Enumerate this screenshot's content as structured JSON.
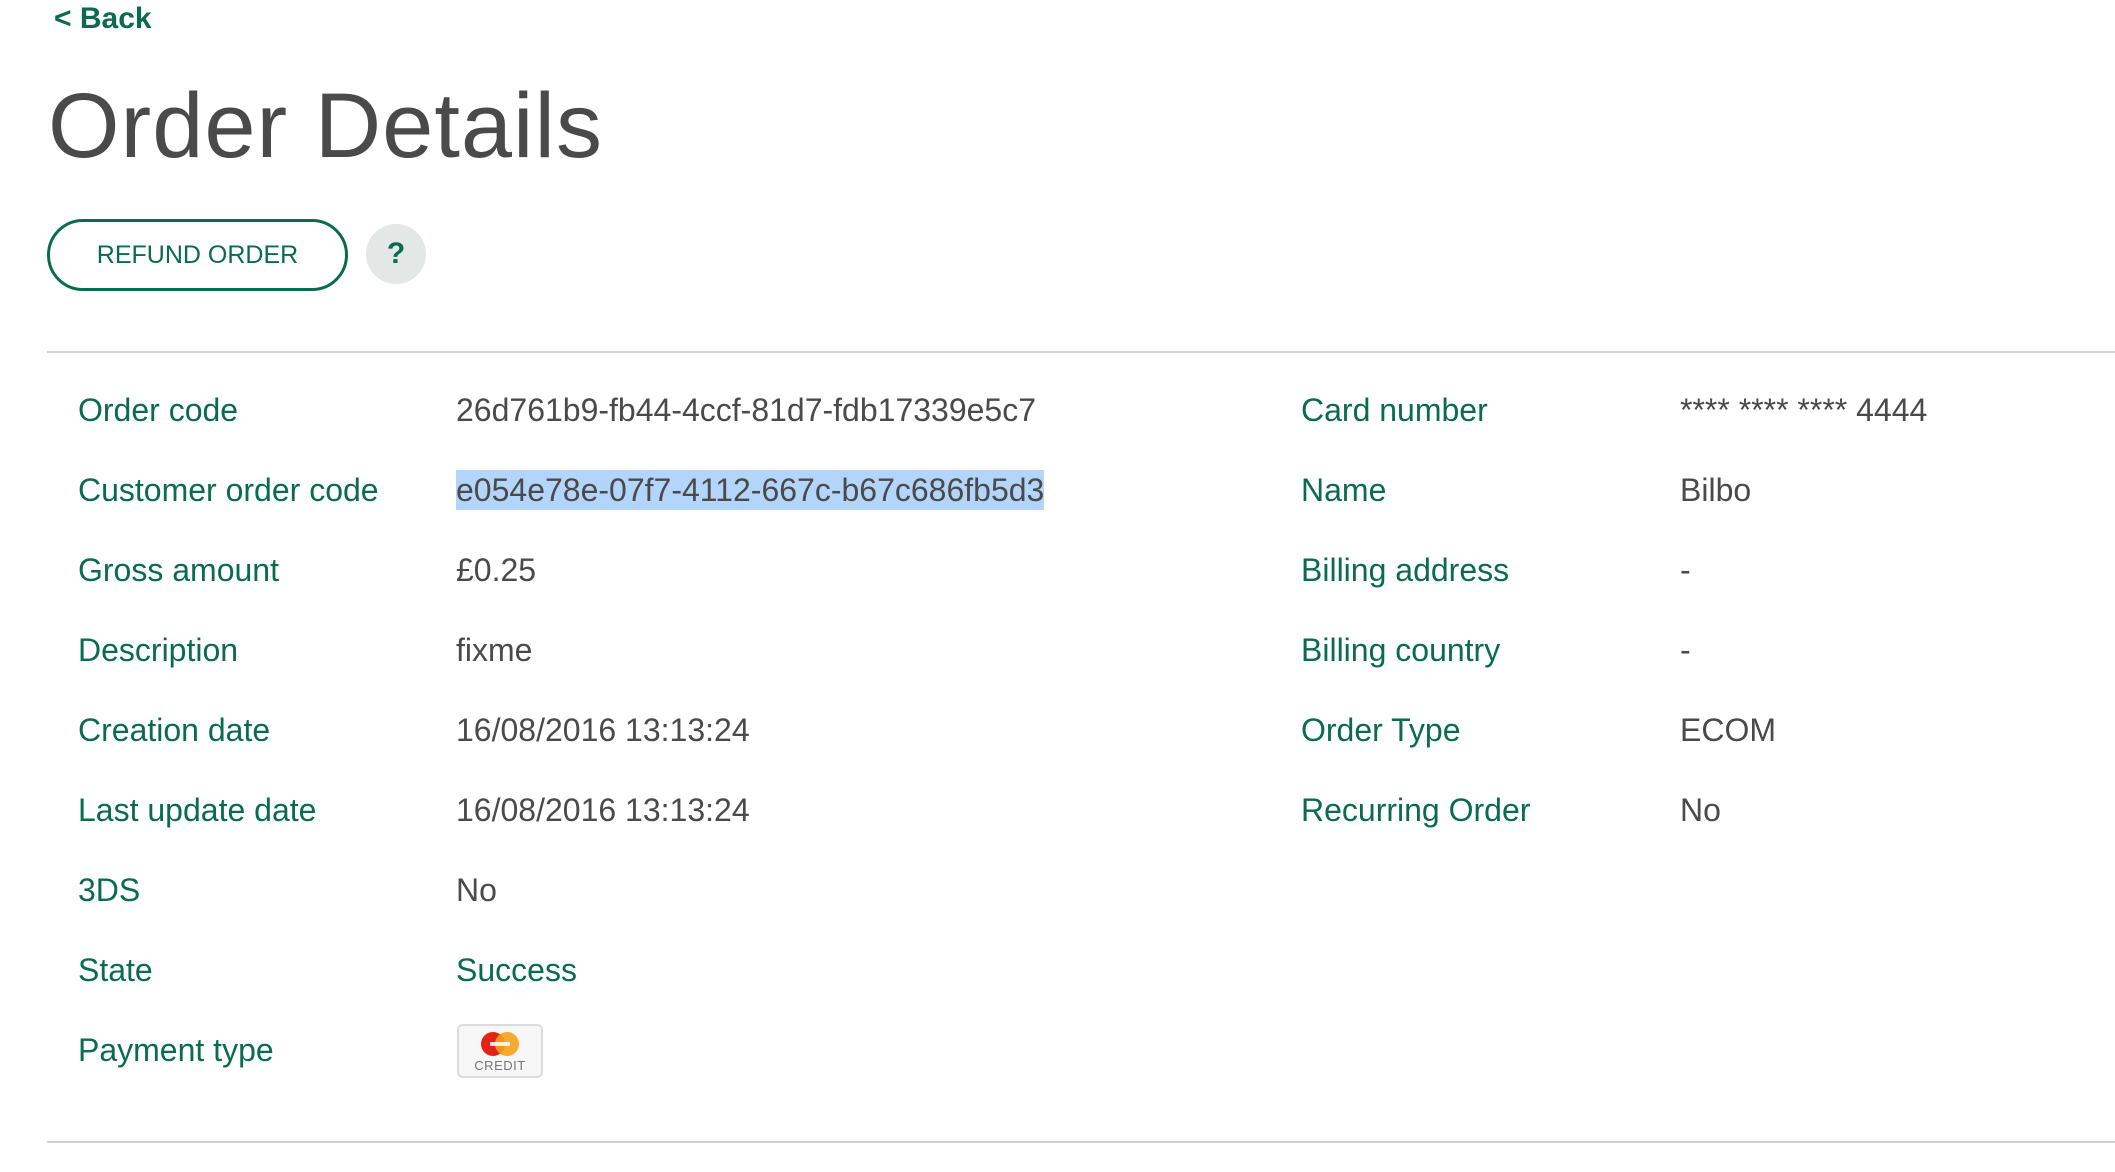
{
  "nav": {
    "back_label": "< Back"
  },
  "page": {
    "title": "Order Details"
  },
  "actions": {
    "refund_label": "REFUND ORDER",
    "help_label": "?"
  },
  "details_left": [
    {
      "label": "Order code",
      "value": "26d761b9-fb44-4ccf-81d7-fdb17339e5c7"
    },
    {
      "label": "Customer order code",
      "value": "e054e78e-07f7-4112-667c-b67c686fb5d3"
    },
    {
      "label": "Gross amount",
      "value": "£0.25"
    },
    {
      "label": "Description",
      "value": "fixme"
    },
    {
      "label": "Creation date",
      "value": "16/08/2016 13:13:24"
    },
    {
      "label": "Last update date",
      "value": "16/08/2016 13:13:24"
    },
    {
      "label": "3DS",
      "value": "No"
    },
    {
      "label": "State",
      "value": "Success"
    },
    {
      "label": "Payment type",
      "value": "CREDIT",
      "icon": "mastercard-credit-icon"
    }
  ],
  "details_right": [
    {
      "label": "Card number",
      "value": "**** **** **** 4444"
    },
    {
      "label": "Name",
      "value": "Bilbo"
    },
    {
      "label": "Billing address",
      "value": "-"
    },
    {
      "label": "Billing country",
      "value": "-"
    },
    {
      "label": "Order Type",
      "value": "ECOM"
    },
    {
      "label": "Recurring Order",
      "value": "No"
    }
  ],
  "colors": {
    "accent": "#0b6b4f",
    "text": "#4a4a4a",
    "selection": "#b4d5fb",
    "divider": "#d2d2d2"
  }
}
